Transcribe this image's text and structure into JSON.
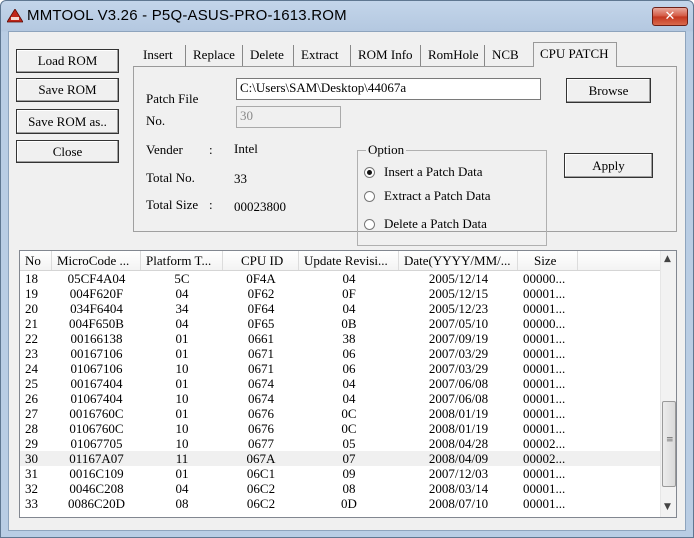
{
  "window": {
    "title": "MMTOOL V3.26 - P5Q-ASUS-PRO-1613.ROM",
    "close_label": "✕"
  },
  "side_buttons": {
    "load": "Load ROM",
    "save": "Save ROM",
    "save_as": "Save ROM as..",
    "close": "Close"
  },
  "tabs": [
    "Insert",
    "Replace",
    "Delete",
    "Extract",
    "ROM Info",
    "RomHole",
    "NCB",
    "CPU PATCH"
  ],
  "active_tab": "CPU PATCH",
  "patch": {
    "patch_file_label": "Patch File",
    "patch_file_value": "C:\\Users\\SAM\\Desktop\\44067a",
    "no_label": "No.",
    "no_value": "30",
    "vender_label": "Vender",
    "vender_sep": ":",
    "vender_value": "Intel",
    "total_no_label": "Total No.",
    "total_no_value": "33",
    "total_size_label": "Total Size",
    "total_size_sep": ":",
    "total_size_value": "00023800",
    "browse": "Browse",
    "apply": "Apply",
    "option_title": "Option",
    "options": [
      "Insert a Patch Data",
      "Extract a Patch Data",
      "Delete a Patch Data"
    ],
    "selected_option": 0
  },
  "list": {
    "columns": [
      "No",
      "MicroCode ...",
      "Platform T...",
      "CPU ID",
      "Update Revisi...",
      "Date(YYYY/MM/...",
      "Size"
    ],
    "rows": [
      [
        "18",
        "05CF4A04",
        "5C",
        "0F4A",
        "04",
        "2005/12/14",
        "00000..."
      ],
      [
        "19",
        "004F620F",
        "04",
        "0F62",
        "0F",
        "2005/12/15",
        "00001..."
      ],
      [
        "20",
        "034F6404",
        "34",
        "0F64",
        "04",
        "2005/12/23",
        "00001..."
      ],
      [
        "21",
        "004F650B",
        "04",
        "0F65",
        "0B",
        "2007/05/10",
        "00000..."
      ],
      [
        "22",
        "00166138",
        "01",
        "0661",
        "38",
        "2007/09/19",
        "00001..."
      ],
      [
        "23",
        "00167106",
        "01",
        "0671",
        "06",
        "2007/03/29",
        "00001..."
      ],
      [
        "24",
        "01067106",
        "10",
        "0671",
        "06",
        "2007/03/29",
        "00001..."
      ],
      [
        "25",
        "00167404",
        "01",
        "0674",
        "04",
        "2007/06/08",
        "00001..."
      ],
      [
        "26",
        "01067404",
        "10",
        "0674",
        "04",
        "2007/06/08",
        "00001..."
      ],
      [
        "27",
        "0016760C",
        "01",
        "0676",
        "0C",
        "2008/01/19",
        "00001..."
      ],
      [
        "28",
        "0106760C",
        "10",
        "0676",
        "0C",
        "2008/01/19",
        "00001..."
      ],
      [
        "29",
        "01067705",
        "10",
        "0677",
        "05",
        "2008/04/28",
        "00002..."
      ],
      [
        "30",
        "01167A07",
        "11",
        "067A",
        "07",
        "2008/04/09",
        "00002..."
      ],
      [
        "31",
        "0016C109",
        "01",
        "06C1",
        "09",
        "2007/12/03",
        "00001..."
      ],
      [
        "32",
        "0046C208",
        "04",
        "06C2",
        "08",
        "2008/03/14",
        "00001..."
      ],
      [
        "33",
        "0086C20D",
        "08",
        "06C2",
        "0D",
        "2008/07/10",
        "00001..."
      ]
    ],
    "highlighted_row": "30",
    "scroll_up": "▲",
    "scroll_down": "▼",
    "grip": "≡"
  }
}
